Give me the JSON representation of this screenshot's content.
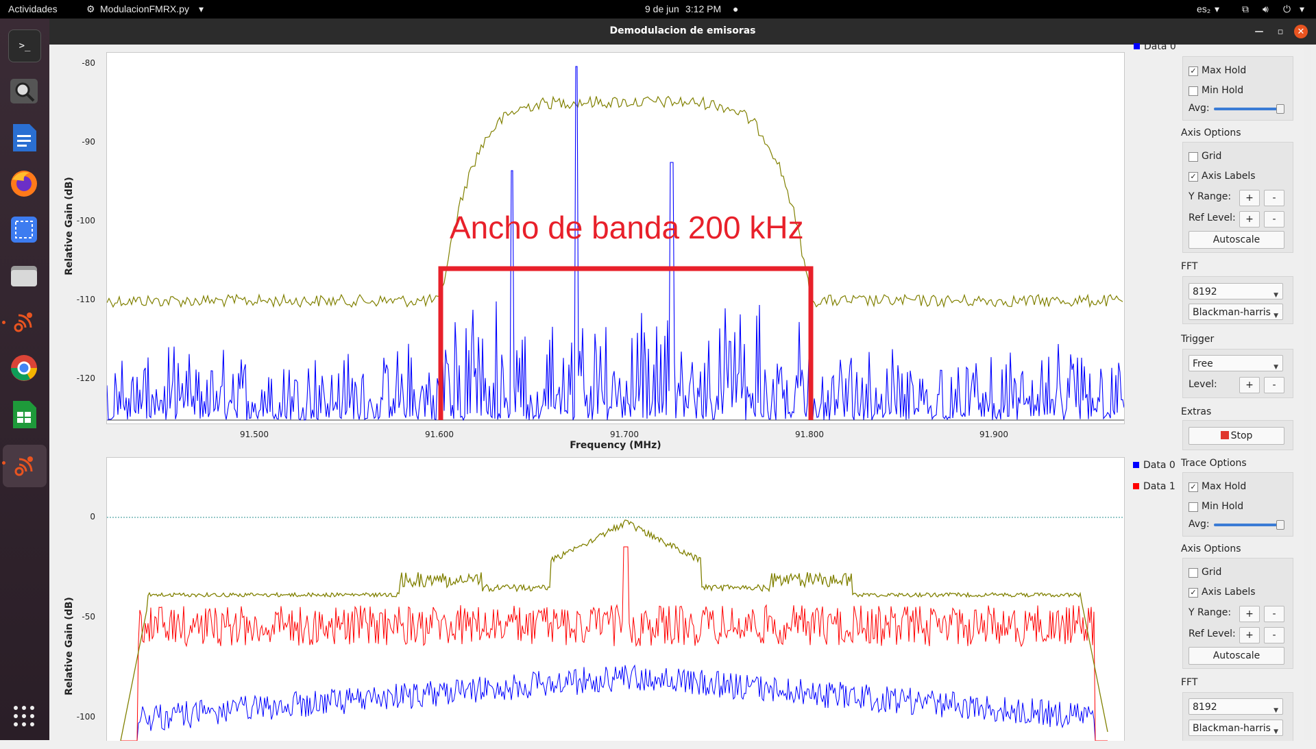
{
  "topbar": {
    "activities": "Actividades",
    "app_name": "ModulacionFMRX.py",
    "date": "9 de jun",
    "time": "3:12 PM",
    "lang": "es₂"
  },
  "window": {
    "title": "Demodulacion  de emisoras"
  },
  "plot1": {
    "ylabel": "Relative Gain (dB)",
    "xlabel": "Frequency (MHz)",
    "yticks": [
      "-80",
      "-90",
      "-100",
      "-110",
      "-120"
    ],
    "xticks": [
      "91.500",
      "91.600",
      "91.700",
      "91.800",
      "91.900"
    ],
    "annotation": "Ancho de banda 200 kHz",
    "legend_partial": "Data 0"
  },
  "plot2": {
    "ylabel": "Relative Gain (dB)",
    "yticks": [
      "0",
      "-50",
      "-100"
    ],
    "legend": [
      {
        "name": "Data 0",
        "color": "#0000ff"
      },
      {
        "name": "Data 1",
        "color": "#ff0000"
      }
    ]
  },
  "panel1": {
    "max_hold": "Max Hold",
    "min_hold": "Min Hold",
    "avg": "Avg:",
    "axis_options": "Axis Options",
    "grid": "Grid",
    "axis_labels": "Axis Labels",
    "y_range": "Y Range:",
    "ref_level": "Ref Level:",
    "plus": "+",
    "minus": "-",
    "autoscale": "Autoscale",
    "fft": "FFT",
    "fft_size": "8192",
    "window": "Blackman-harris",
    "trigger": "Trigger",
    "trigger_mode": "Free",
    "level": "Level:",
    "extras": "Extras",
    "stop": "Stop"
  },
  "panel2": {
    "trace_options": "Trace Options",
    "max_hold": "Max Hold",
    "min_hold": "Min Hold",
    "avg": "Avg:",
    "axis_options": "Axis Options",
    "grid": "Grid",
    "axis_labels": "Axis Labels",
    "y_range": "Y Range:",
    "ref_level": "Ref Level:",
    "plus": "+",
    "minus": "-",
    "autoscale": "Autoscale",
    "fft": "FFT",
    "fft_size": "8192",
    "window": "Blackman-harris"
  },
  "colors": {
    "trace_blue": "#0000ff",
    "trace_olive": "#808000",
    "trace_red": "#ff0000",
    "annotation": "#e8202a"
  }
}
